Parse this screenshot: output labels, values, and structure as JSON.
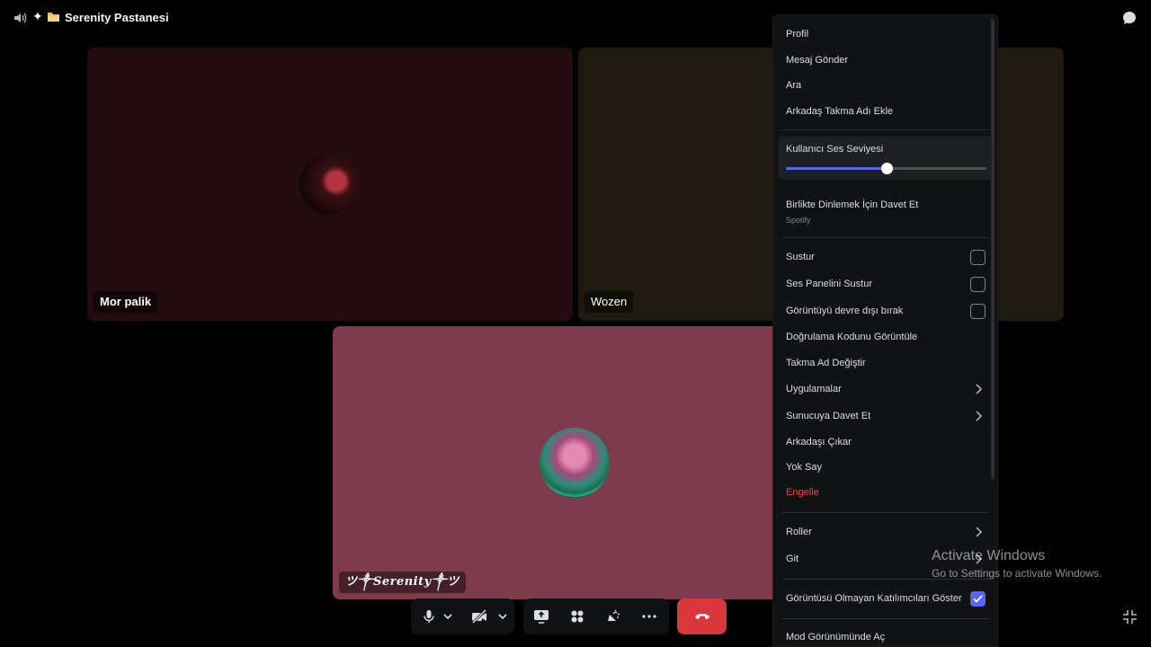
{
  "header": {
    "title": "Serenity Pastanesi"
  },
  "tiles": [
    {
      "name": "Mor palik"
    },
    {
      "name": "Wozen"
    },
    {
      "name": "ツ༒Serenity༒ツ"
    }
  ],
  "menu": {
    "items": {
      "profile": "Profil",
      "send_message": "Mesaj Gönder",
      "call": "Ara",
      "add_nickname": "Arkadaş Takma Adı Ekle",
      "user_volume": "Kullanıcı Ses Seviyesi",
      "invite_listen": "Birlikte Dinlemek İçin Davet Et",
      "invite_listen_sub": "Spotify",
      "mute": "Sustur",
      "mute_soundboard": "Ses Panelini Sustur",
      "disable_video": "Görüntüyü devre dışı bırak",
      "view_verification": "Doğrulama Kodunu Görüntüle",
      "change_nickname": "Takma Ad Değiştir",
      "apps": "Uygulamalar",
      "invite_server": "Sunucuya Davet Et",
      "remove_friend": "Arkadaşı Çıkar",
      "ignore": "Yok Say",
      "block": "Engelle",
      "roles": "Roller",
      "move": "Git",
      "show_non_video": "Görüntüsü Olmayan Katılımcıları Göster",
      "focus_mode": "Mod Görünümünde Aç"
    },
    "volume_level": 0.5,
    "checkboxes": {
      "mute": false,
      "mute_soundboard": false,
      "disable_video": false,
      "show_non_video": true
    }
  },
  "watermark": {
    "title": "Activate Windows",
    "subtitle": "Go to Settings to activate Windows."
  },
  "colors": {
    "accent": "#5865f2",
    "danger": "#f23f43",
    "hangup": "#da373c"
  }
}
